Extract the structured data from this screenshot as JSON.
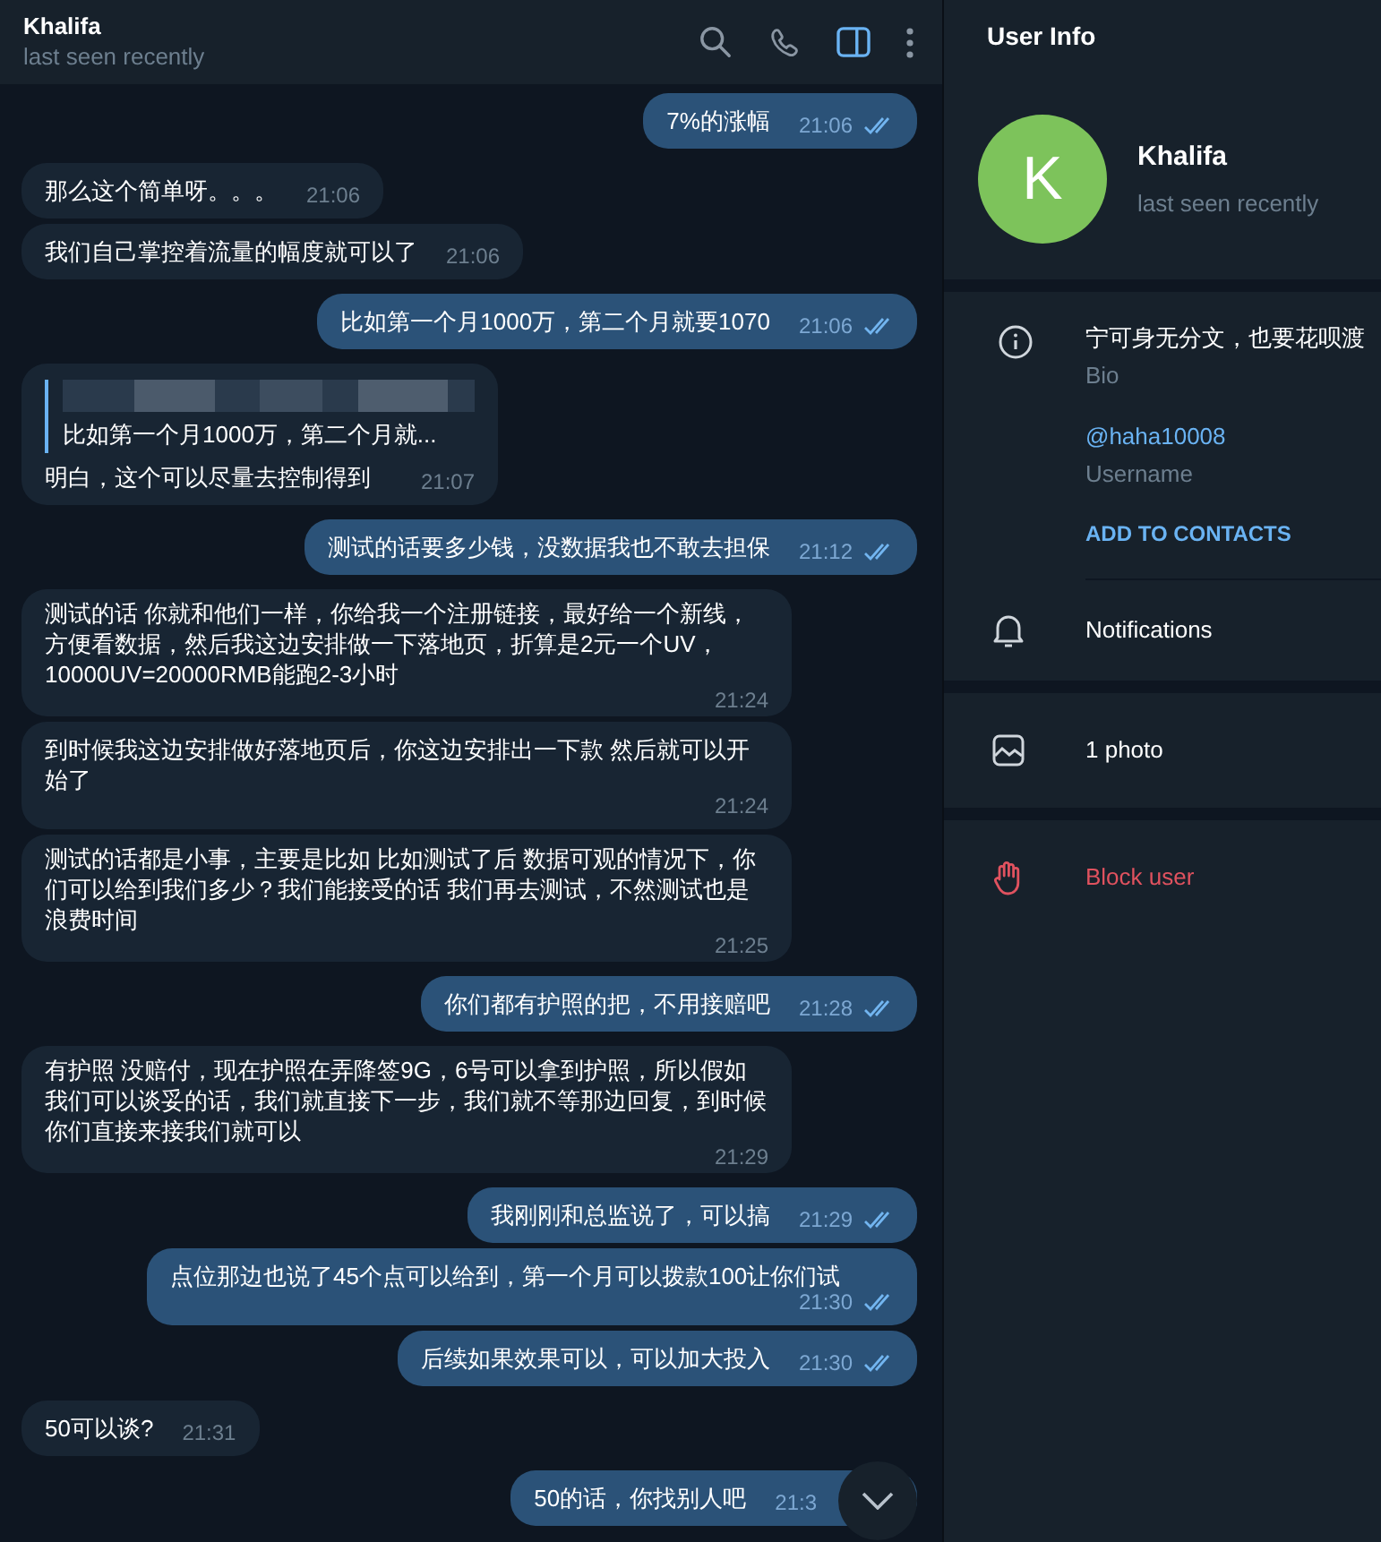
{
  "chat_header": {
    "name": "Khalifa",
    "status": "last seen recently",
    "sidebar_toggle": {
      "selected": true
    }
  },
  "messages": [
    {
      "kind": "out",
      "text": "7%的涨幅",
      "time": "21:06",
      "read": true
    },
    {
      "kind": "in",
      "text": "那么这个简单呀。。。",
      "time": "21:06"
    },
    {
      "kind": "in",
      "text": "我们自己掌控着流量的幅度就可以了",
      "time": "21:06"
    },
    {
      "kind": "out",
      "text": "比如第一个月1000万，第二个月就要1070",
      "time": "21:06",
      "read": true
    },
    {
      "kind": "in",
      "reply": {
        "text": "比如第一个月1000万，第二个月就..."
      },
      "text": "明白，这个可以尽量去控制得到",
      "time": "21:07"
    },
    {
      "kind": "out",
      "text": "测试的话要多少钱，没数据我也不敢去担保",
      "time": "21:12",
      "read": true
    },
    {
      "kind": "in",
      "text": "测试的话 你就和他们一样，你给我一个注册链接，最好给一个新线，方便看数据，然后我这边安排做一下落地页，折算是2元一个UV，10000UV=20000RMB能跑2-3小时",
      "time": "21:24"
    },
    {
      "kind": "in",
      "text": "到时候我这边安排做好落地页后，你这边安排出一下款 然后就可以开始了",
      "time": "21:24"
    },
    {
      "kind": "in",
      "text": "测试的话都是小事，主要是比如 比如测试了后 数据可观的情况下，你们可以给到我们多少？我们能接受的话 我们再去测试，不然测试也是浪费时间",
      "time": "21:25"
    },
    {
      "kind": "out",
      "text": "你们都有护照的把，不用接赔吧",
      "time": "21:28",
      "read": true
    },
    {
      "kind": "in",
      "text": "有护照 没赔付，现在护照在弄降签9G，6号可以拿到护照，所以假如我们可以谈妥的话，我们就直接下一步，我们就不等那边回复，到时候你们直接来接我们就可以",
      "time": "21:29"
    },
    {
      "kind": "out",
      "text": "我刚刚和总监说了，可以搞",
      "time": "21:29",
      "read": true
    },
    {
      "kind": "out",
      "text": "点位那边也说了45个点可以给到，第一个月可以拨款100让你们试",
      "time": "21:30",
      "read": true
    },
    {
      "kind": "out",
      "text": "后续如果效果可以，可以加大投入",
      "time": "21:30",
      "read": true
    },
    {
      "kind": "in",
      "text": "50可以谈?",
      "time": "21:31"
    },
    {
      "kind": "out",
      "text": "50的话，你找别人吧",
      "time": "21:3"
    }
  ],
  "user_info": {
    "title": "User Info",
    "avatar_letter": "K",
    "name": "Khalifa",
    "status": "last seen recently",
    "bio": {
      "value": "宁可身无分文，也要花呗渡",
      "label": "Bio"
    },
    "username": {
      "value": "@haha10008",
      "label": "Username"
    },
    "add_contact": "ADD TO CONTACTS",
    "notifications": "Notifications",
    "photos": "1 photo",
    "block": "Block user"
  }
}
